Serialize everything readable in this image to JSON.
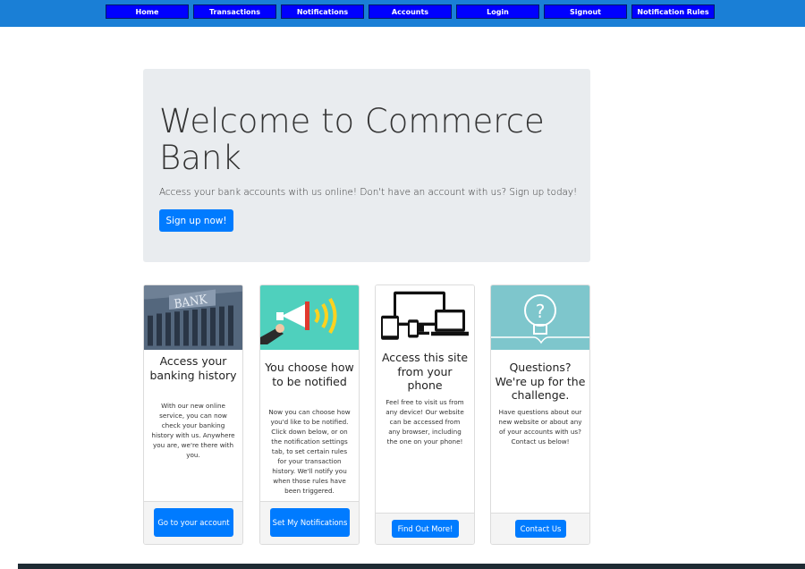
{
  "nav": {
    "items": [
      "Home",
      "Transactions",
      "Notifications",
      "Accounts",
      "Login",
      "Signout",
      "Notification Rules"
    ]
  },
  "hero": {
    "title": "Welcome to Commerce Bank",
    "subtitle": "Access your bank accounts with us online! Don't have an account with us? Sign up today!",
    "button": "Sign up now!"
  },
  "cards": [
    {
      "image_text": "BANK",
      "title": "Access your banking history",
      "text": "With our new online service, you can now check your banking history with us. Anywhere you are, we're there with you.",
      "button": "Go to your account"
    },
    {
      "title": "You choose how to be notified",
      "text": "Now you can choose how you'd like to be notified. Click down below, or on the notification settings tab, to set certain rules for your transaction history. We'll notify you when those rules have been triggered.",
      "button": "Set My Notifications"
    },
    {
      "title": "Access this site from your phone",
      "text": "Feel free to visit us from any device! Our website can be accessed from any browser, including the one on your phone!",
      "button": "Find Out More!"
    },
    {
      "title": "Questions? We're up for the challenge.",
      "text": "Have questions about our new website or about any of your accounts with us? Contact us below!",
      "button": "Contact Us"
    }
  ],
  "colors": {
    "topbar": "#1a7fd6",
    "nav_button": "#0000ff",
    "primary": "#007bff",
    "jumbotron": "#e9ecef",
    "notify_image_bg": "#4fd0bd",
    "questions_image_bg": "#7ec6cc"
  },
  "icons": [
    "bank-building-image",
    "megaphone-icon",
    "devices-icon",
    "lightbulb-question-icon"
  ]
}
